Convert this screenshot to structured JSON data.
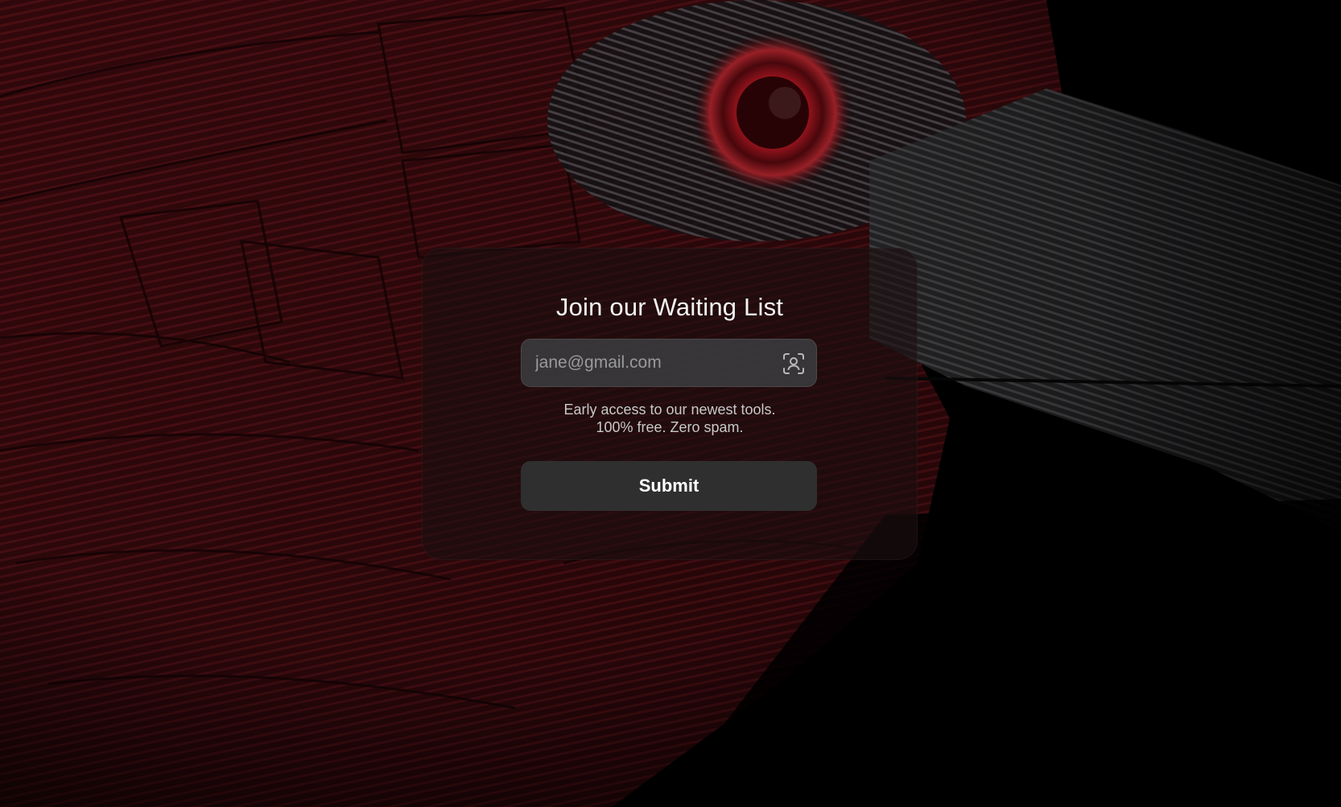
{
  "signup": {
    "title": "Join our Waiting List",
    "email_placeholder": "jane@gmail.com",
    "email_value": "",
    "email_icon": "face-id-icon",
    "note_line1": "Early access to our newest tools.",
    "note_line2": "100% free. Zero spam.",
    "submit_label": "Submit"
  },
  "background": {
    "description_icon": "bird-feather-artwork",
    "accent_color": "#8e1a22",
    "base_color": "#000000"
  }
}
